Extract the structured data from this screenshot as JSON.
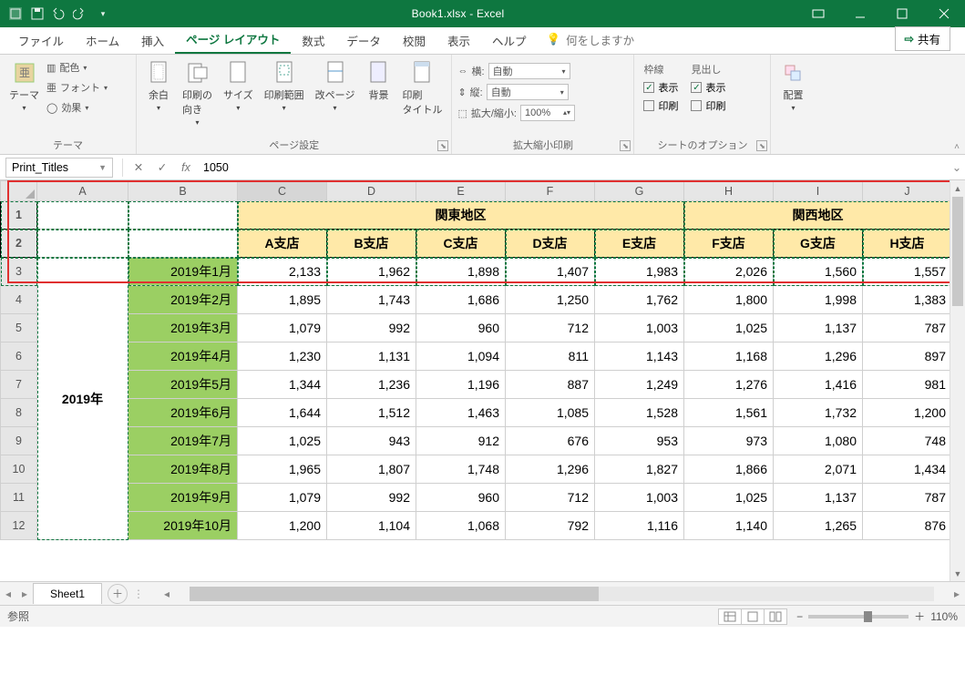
{
  "title": "Book1.xlsx - Excel",
  "tabs": [
    "ファイル",
    "ホーム",
    "挿入",
    "ページ レイアウト",
    "数式",
    "データ",
    "校閲",
    "表示",
    "ヘルプ"
  ],
  "active_tab": 3,
  "tellme": "何をしますか",
  "share": "共有",
  "ribbon": {
    "theme": {
      "label": "テーマ",
      "btn": "テーマ",
      "items": [
        "配色",
        "フォント",
        "効果"
      ]
    },
    "page_setup": {
      "label": "ページ設定",
      "btns": [
        "余白",
        "印刷の\n向き",
        "サイズ",
        "印刷範囲",
        "改ページ",
        "背景",
        "印刷\nタイトル"
      ]
    },
    "scale": {
      "label": "拡大縮小印刷",
      "w": "横:",
      "h": "縦:",
      "s": "拡大/縮小:",
      "auto": "自動",
      "pct": "100%"
    },
    "sheet_opts": {
      "label": "シートのオプション",
      "grid": "枠線",
      "head": "見出し",
      "show": "表示",
      "print": "印刷"
    },
    "arrange": {
      "label": "",
      "btn": "配置"
    }
  },
  "namebox": "Print_Titles",
  "fx_value": "1050",
  "cols": [
    "A",
    "B",
    "C",
    "D",
    "E",
    "F",
    "G",
    "H",
    "I",
    "J"
  ],
  "rows": [
    "1",
    "2",
    "3",
    "4",
    "5",
    "6",
    "7",
    "8",
    "9",
    "10",
    "11",
    "12"
  ],
  "regions": {
    "kanto": "関東地区",
    "kansai": "関西地区"
  },
  "stores": [
    "A支店",
    "B支店",
    "C支店",
    "D支店",
    "E支店",
    "F支店",
    "G支店",
    "H支店"
  ],
  "year": "2019年",
  "months": [
    "2019年1月",
    "2019年2月",
    "2019年3月",
    "2019年4月",
    "2019年5月",
    "2019年6月",
    "2019年7月",
    "2019年8月",
    "2019年9月",
    "2019年10月"
  ],
  "data": [
    [
      "2,133",
      "1,962",
      "1,898",
      "1,407",
      "1,983",
      "2,026",
      "1,560",
      "1,557"
    ],
    [
      "1,895",
      "1,743",
      "1,686",
      "1,250",
      "1,762",
      "1,800",
      "1,998",
      "1,383"
    ],
    [
      "1,079",
      "992",
      "960",
      "712",
      "1,003",
      "1,025",
      "1,137",
      "787"
    ],
    [
      "1,230",
      "1,131",
      "1,094",
      "811",
      "1,143",
      "1,168",
      "1,296",
      "897"
    ],
    [
      "1,344",
      "1,236",
      "1,196",
      "887",
      "1,249",
      "1,276",
      "1,416",
      "981"
    ],
    [
      "1,644",
      "1,512",
      "1,463",
      "1,085",
      "1,528",
      "1,561",
      "1,732",
      "1,200"
    ],
    [
      "1,025",
      "943",
      "912",
      "676",
      "953",
      "973",
      "1,080",
      "748"
    ],
    [
      "1,965",
      "1,807",
      "1,748",
      "1,296",
      "1,827",
      "1,866",
      "2,071",
      "1,434"
    ],
    [
      "1,079",
      "992",
      "960",
      "712",
      "1,003",
      "1,025",
      "1,137",
      "787"
    ],
    [
      "1,200",
      "1,104",
      "1,068",
      "792",
      "1,116",
      "1,140",
      "1,265",
      "876"
    ]
  ],
  "sheet_tab": "Sheet1",
  "status": "参照",
  "zoom": "110%",
  "chart_data": {
    "type": "table",
    "title": "2019年 支店別データ",
    "columns": [
      "月",
      "A支店",
      "B支店",
      "C支店",
      "D支店",
      "E支店",
      "F支店",
      "G支店",
      "H支店"
    ],
    "regions": {
      "関東地区": [
        "A支店",
        "B支店",
        "C支店",
        "D支店",
        "E支店"
      ],
      "関西地区": [
        "F支店",
        "G支店",
        "H支店"
      ]
    },
    "rows": [
      {
        "月": "2019年1月",
        "A支店": 2133,
        "B支店": 1962,
        "C支店": 1898,
        "D支店": 1407,
        "E支店": 1983,
        "F支店": 2026,
        "G支店": 1560,
        "H支店": 1557
      },
      {
        "月": "2019年2月",
        "A支店": 1895,
        "B支店": 1743,
        "C支店": 1686,
        "D支店": 1250,
        "E支店": 1762,
        "F支店": 1800,
        "G支店": 1998,
        "H支店": 1383
      },
      {
        "月": "2019年3月",
        "A支店": 1079,
        "B支店": 992,
        "C支店": 960,
        "D支店": 712,
        "E支店": 1003,
        "F支店": 1025,
        "G支店": 1137,
        "H支店": 787
      },
      {
        "月": "2019年4月",
        "A支店": 1230,
        "B支店": 1131,
        "C支店": 1094,
        "D支店": 811,
        "E支店": 1143,
        "F支店": 1168,
        "G支店": 1296,
        "H支店": 897
      },
      {
        "月": "2019年5月",
        "A支店": 1344,
        "B支店": 1236,
        "C支店": 1196,
        "D支店": 887,
        "E支店": 1249,
        "F支店": 1276,
        "G支店": 1416,
        "H支店": 981
      },
      {
        "月": "2019年6月",
        "A支店": 1644,
        "B支店": 1512,
        "C支店": 1463,
        "D支店": 1085,
        "E支店": 1528,
        "F支店": 1561,
        "G支店": 1732,
        "H支店": 1200
      },
      {
        "月": "2019年7月",
        "A支店": 1025,
        "B支店": 943,
        "C支店": 912,
        "D支店": 676,
        "E支店": 953,
        "F支店": 973,
        "G支店": 1080,
        "H支店": 748
      },
      {
        "月": "2019年8月",
        "A支店": 1965,
        "B支店": 1807,
        "C支店": 1748,
        "D支店": 1296,
        "E支店": 1827,
        "F支店": 1866,
        "G支店": 2071,
        "H支店": 1434
      },
      {
        "月": "2019年9月",
        "A支店": 1079,
        "B支店": 992,
        "C支店": 960,
        "D支店": 712,
        "E支店": 1003,
        "F支店": 1025,
        "G支店": 1137,
        "H支店": 787
      },
      {
        "月": "2019年10月",
        "A支店": 1200,
        "B支店": 1104,
        "C支店": 1068,
        "D支店": 792,
        "E支店": 1116,
        "F支店": 1140,
        "G支店": 1265,
        "H支店": 876
      }
    ]
  }
}
